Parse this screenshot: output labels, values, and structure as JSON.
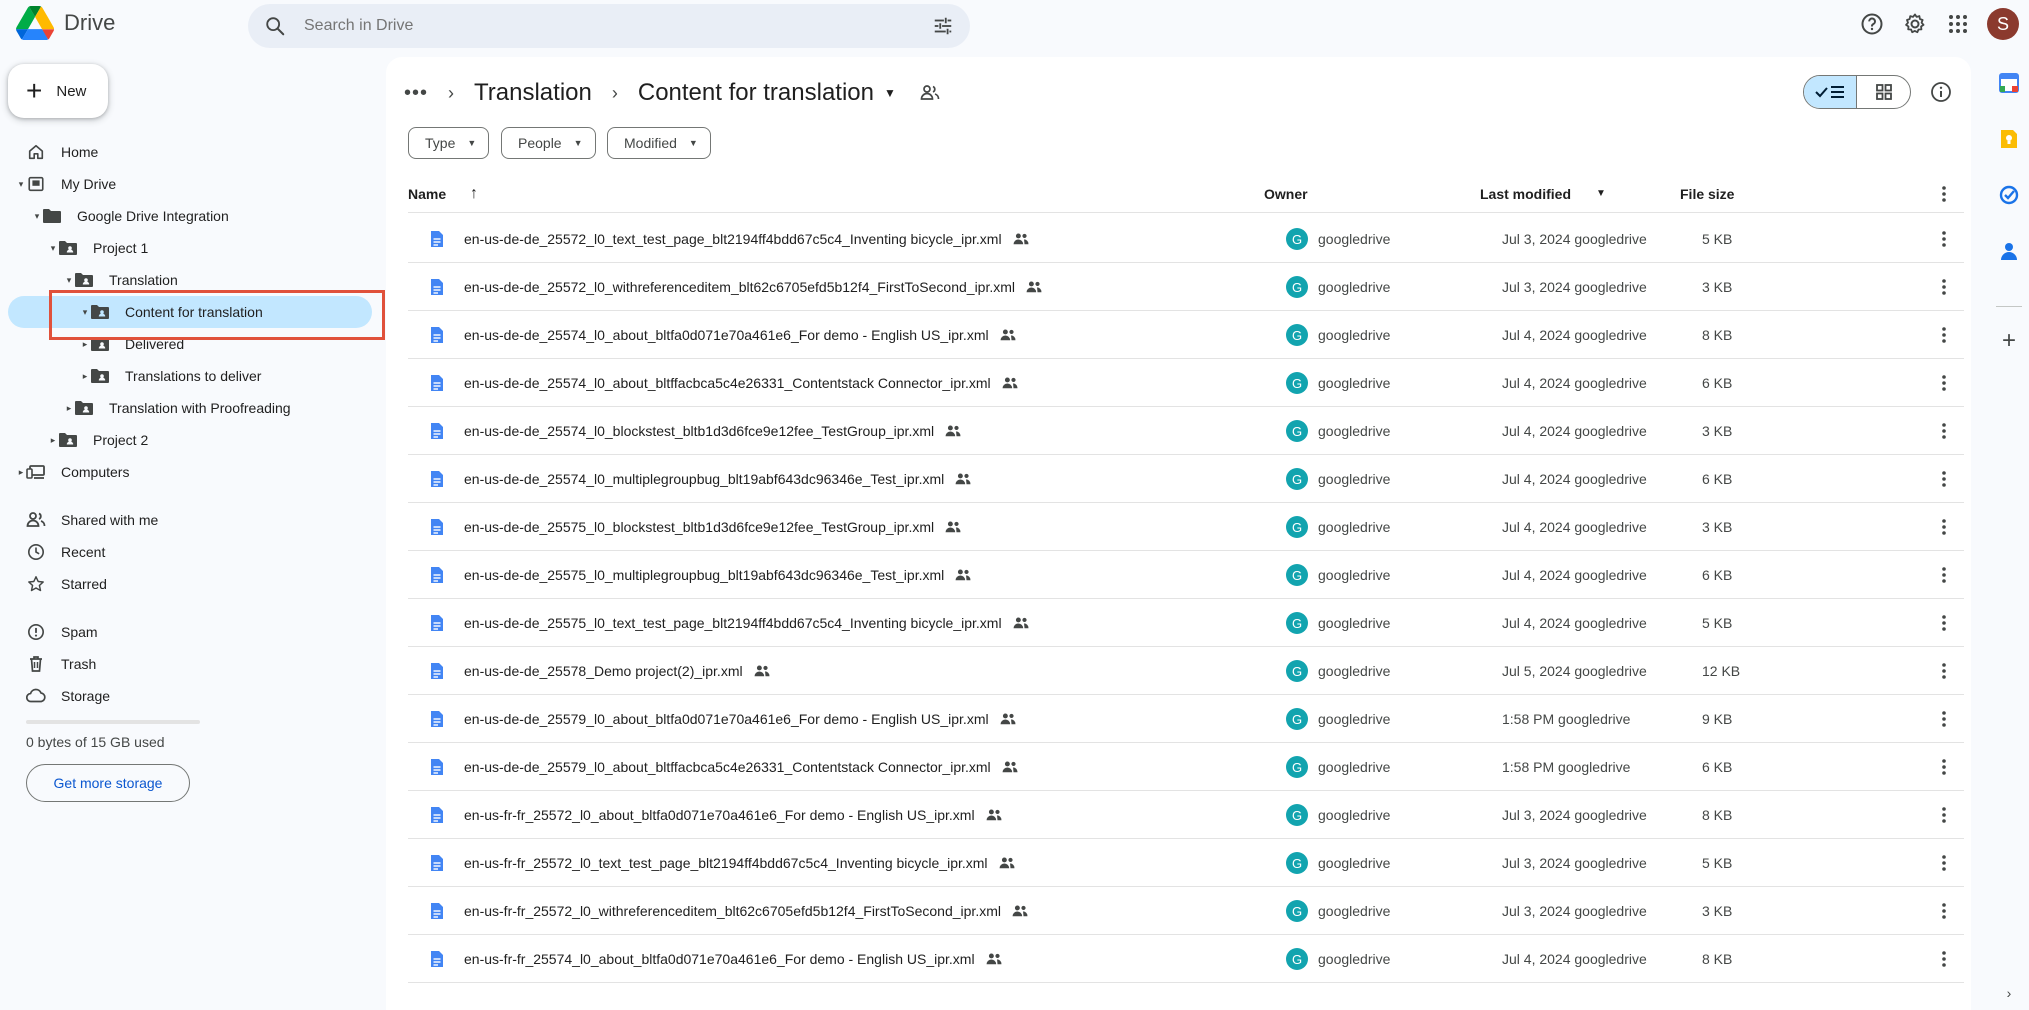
{
  "app": {
    "title": "Drive",
    "avatar_letter": "S",
    "accent": "#0b57d0",
    "selected_bg": "#c2e7ff"
  },
  "search": {
    "placeholder": "Search in Drive"
  },
  "new_button": {
    "label": "New"
  },
  "sidebar": {
    "items": [
      {
        "label": "Home",
        "icon": "home-icon"
      },
      {
        "label": "My Drive",
        "icon": "my-drive-icon"
      },
      {
        "label": "Google Drive Integration",
        "icon": "folder-icon"
      },
      {
        "label": "Project 1",
        "icon": "shared-folder-icon"
      },
      {
        "label": "Translation",
        "icon": "shared-folder-icon"
      },
      {
        "label": "Content for translation",
        "icon": "shared-folder-icon"
      },
      {
        "label": "Delivered",
        "icon": "shared-folder-icon"
      },
      {
        "label": "Translations to deliver",
        "icon": "shared-folder-icon"
      },
      {
        "label": "Translation with Proofreading",
        "icon": "shared-folder-icon"
      },
      {
        "label": "Project 2",
        "icon": "shared-folder-icon"
      },
      {
        "label": "Computers",
        "icon": "computers-icon"
      },
      {
        "label": "Shared with me",
        "icon": "shared-with-me-icon"
      },
      {
        "label": "Recent",
        "icon": "clock-icon"
      },
      {
        "label": "Starred",
        "icon": "star-icon"
      },
      {
        "label": "Spam",
        "icon": "spam-icon"
      },
      {
        "label": "Trash",
        "icon": "trash-icon"
      },
      {
        "label": "Storage",
        "icon": "cloud-icon"
      }
    ],
    "storage_text": "0 bytes of 15 GB used",
    "get_storage_label": "Get more storage"
  },
  "breadcrumb": {
    "parent": "Translation",
    "current": "Content for translation"
  },
  "filters": {
    "type": "Type",
    "people": "People",
    "modified": "Modified"
  },
  "table": {
    "headers": {
      "name": "Name",
      "owner": "Owner",
      "last_modified": "Last modified",
      "file_size": "File size"
    },
    "rows": [
      {
        "name": "en-us-de-de_25572_l0_text_test_page_blt2194ff4bdd67c5c4_Inventing bicycle_ipr.xml",
        "owner": "googledrive",
        "modified": "Jul 3, 2024 googledrive",
        "size": "5 KB"
      },
      {
        "name": "en-us-de-de_25572_l0_withreferenceditem_blt62c6705efd5b12f4_FirstToSecond_ipr.xml",
        "owner": "googledrive",
        "modified": "Jul 3, 2024 googledrive",
        "size": "3 KB"
      },
      {
        "name": "en-us-de-de_25574_l0_about_bltfa0d071e70a461e6_For demo - English US_ipr.xml",
        "owner": "googledrive",
        "modified": "Jul 4, 2024 googledrive",
        "size": "8 KB"
      },
      {
        "name": "en-us-de-de_25574_l0_about_bltffacbca5c4e26331_Contentstack Connector_ipr.xml",
        "owner": "googledrive",
        "modified": "Jul 4, 2024 googledrive",
        "size": "6 KB"
      },
      {
        "name": "en-us-de-de_25574_l0_blockstest_bltb1d3d6fce9e12fee_TestGroup_ipr.xml",
        "owner": "googledrive",
        "modified": "Jul 4, 2024 googledrive",
        "size": "3 KB"
      },
      {
        "name": "en-us-de-de_25574_l0_multiplegroupbug_blt19abf643dc96346e_Test_ipr.xml",
        "owner": "googledrive",
        "modified": "Jul 4, 2024 googledrive",
        "size": "6 KB"
      },
      {
        "name": "en-us-de-de_25575_l0_blockstest_bltb1d3d6fce9e12fee_TestGroup_ipr.xml",
        "owner": "googledrive",
        "modified": "Jul 4, 2024 googledrive",
        "size": "3 KB"
      },
      {
        "name": "en-us-de-de_25575_l0_multiplegroupbug_blt19abf643dc96346e_Test_ipr.xml",
        "owner": "googledrive",
        "modified": "Jul 4, 2024 googledrive",
        "size": "6 KB"
      },
      {
        "name": "en-us-de-de_25575_l0_text_test_page_blt2194ff4bdd67c5c4_Inventing bicycle_ipr.xml",
        "owner": "googledrive",
        "modified": "Jul 4, 2024 googledrive",
        "size": "5 KB"
      },
      {
        "name": "en-us-de-de_25578_Demo project(2)_ipr.xml",
        "owner": "googledrive",
        "modified": "Jul 5, 2024 googledrive",
        "size": "12 KB"
      },
      {
        "name": "en-us-de-de_25579_l0_about_bltfa0d071e70a461e6_For demo - English US_ipr.xml",
        "owner": "googledrive",
        "modified": "1:58 PM googledrive",
        "size": "9 KB"
      },
      {
        "name": "en-us-de-de_25579_l0_about_bltffacbca5c4e26331_Contentstack Connector_ipr.xml",
        "owner": "googledrive",
        "modified": "1:58 PM googledrive",
        "size": "6 KB"
      },
      {
        "name": "en-us-fr-fr_25572_l0_about_bltfa0d071e70a461e6_For demo - English US_ipr.xml",
        "owner": "googledrive",
        "modified": "Jul 3, 2024 googledrive",
        "size": "8 KB"
      },
      {
        "name": "en-us-fr-fr_25572_l0_text_test_page_blt2194ff4bdd67c5c4_Inventing bicycle_ipr.xml",
        "owner": "googledrive",
        "modified": "Jul 3, 2024 googledrive",
        "size": "5 KB"
      },
      {
        "name": "en-us-fr-fr_25572_l0_withreferenceditem_blt62c6705efd5b12f4_FirstToSecond_ipr.xml",
        "owner": "googledrive",
        "modified": "Jul 3, 2024 googledrive",
        "size": "3 KB"
      },
      {
        "name": "en-us-fr-fr_25574_l0_about_bltfa0d071e70a461e6_For demo - English US_ipr.xml",
        "owner": "googledrive",
        "modified": "Jul 4, 2024 googledrive",
        "size": "8 KB"
      }
    ]
  }
}
